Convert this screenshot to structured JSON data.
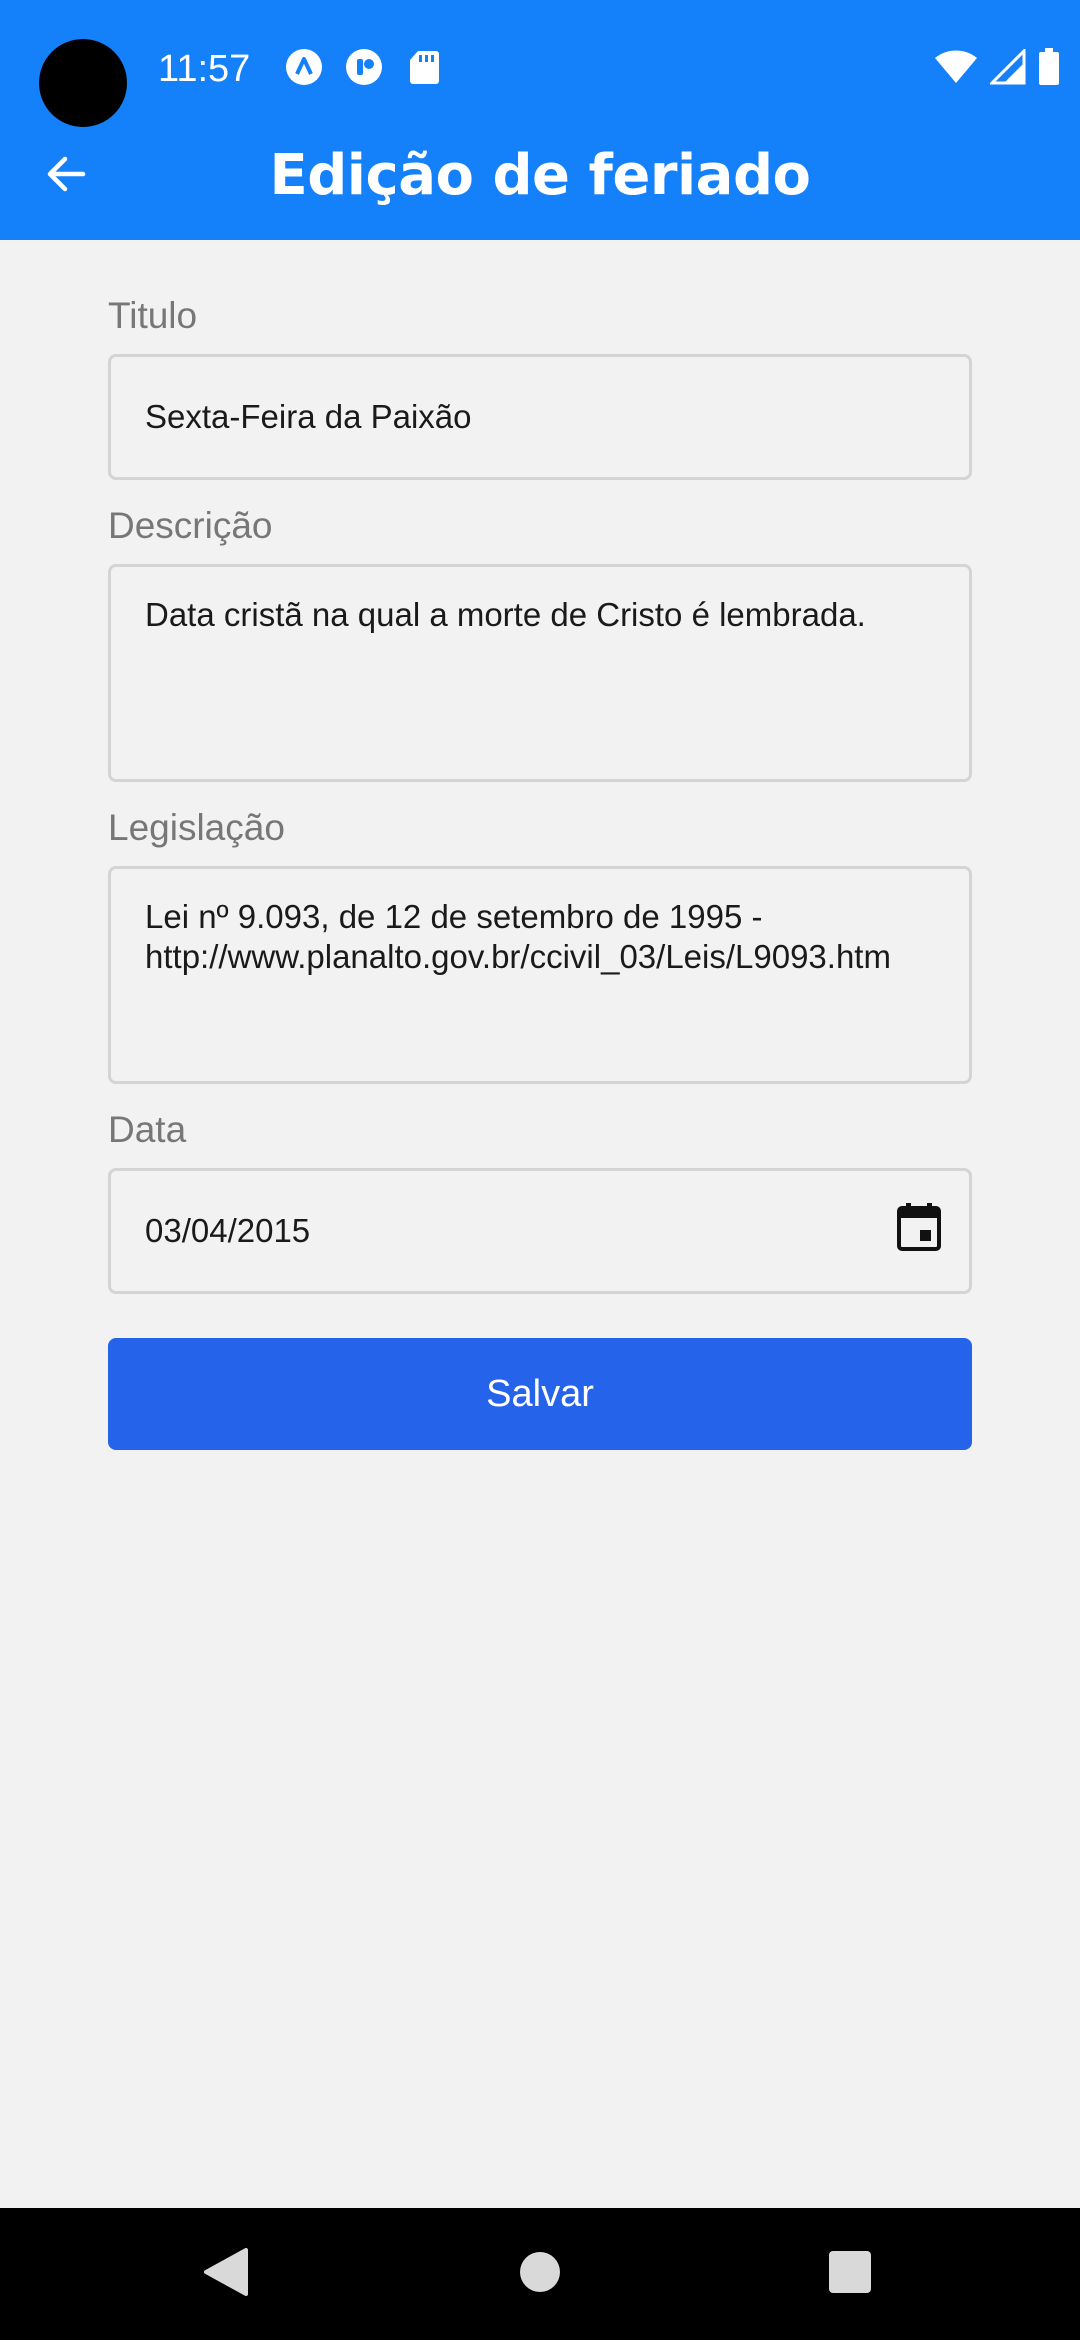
{
  "status_bar": {
    "time": "11:57",
    "left_icons": [
      "app-notification-icon",
      "app-notification-icon-2",
      "sd-card-icon"
    ],
    "right_icons": [
      "wifi-icon",
      "cell-signal-icon",
      "battery-icon"
    ]
  },
  "header": {
    "title": "Edição de feriado",
    "back_icon": "arrow-left-icon"
  },
  "form": {
    "titulo": {
      "label": "Titulo",
      "value": "Sexta-Feira da Paixão"
    },
    "descricao": {
      "label": "Descrição",
      "value": "Data cristã na qual a morte de Cristo é lembrada."
    },
    "legislacao": {
      "label": "Legislação",
      "value_line1": "Lei nº 9.093, de 12 de setembro de 1995 -",
      "value_line2": "http://www.planalto.gov.br/ccivil_03/Leis/L9093.htm"
    },
    "data": {
      "label": "Data",
      "value": "03/04/2015",
      "icon": "calendar-icon"
    },
    "save_label": "Salvar"
  },
  "nav_bar": {
    "icons": [
      "back-triangle-icon",
      "home-circle-icon",
      "recents-square-icon"
    ]
  },
  "colors": {
    "app_bar": "#1480fa",
    "save_button": "#2563eb",
    "background": "#f2f2f2",
    "label_text": "#777777"
  }
}
